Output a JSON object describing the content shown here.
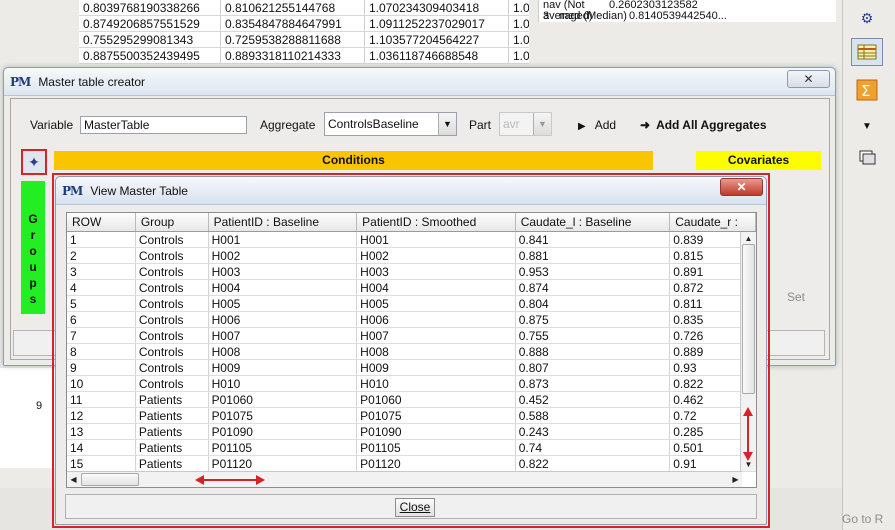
{
  "background_table": {
    "rows": [
      [
        "0.8039768190338266",
        "0.810621255144768",
        "1.070234309403418",
        "1.0"
      ],
      [
        "0.8749206857551529",
        "0.8354847884647991",
        "1.0911252237029017",
        "1.0"
      ],
      [
        "0.755295299081343",
        "0.7259538288811688",
        "1.103577204564227",
        "1.0"
      ],
      [
        "0.8875500352439495",
        "0.8893318110214333",
        "1.036118746688548",
        "1.0"
      ]
    ]
  },
  "background_list": {
    "rows": [
      {
        "index": "2",
        "label": "nav (Not averaged)",
        "value": "0.2602303123582"
      },
      {
        "index": "3",
        "label": "med (Median)",
        "value": "0.8140539442540..."
      }
    ]
  },
  "background_number": "9",
  "right_toolbar": {
    "icons": [
      "plugin-icon",
      "table-icon",
      "sum-icon",
      "dropdown-arrow-icon",
      "copy-icon"
    ]
  },
  "master_table_creator": {
    "title": "Master table creator",
    "logo": "PM",
    "variable_label": "Variable",
    "variable_value": "MasterTable",
    "aggregate_label": "Aggregate",
    "aggregate_value": "ControlsBaseline",
    "part_label": "Part",
    "part_value": "avr",
    "add_label": "Add",
    "add_all_label": "Add All Aggregates",
    "conditions_label": "Conditions",
    "covariates_label": "Covariates",
    "groups_label": [
      "G",
      "r",
      "o",
      "u",
      "p",
      "s"
    ],
    "set_label": "Set"
  },
  "view_master_table": {
    "title": "View Master Table",
    "close_label": "Close",
    "columns": [
      "ROW",
      "Group",
      "PatientID : Baseline",
      "PatientID : Smoothed",
      "Caudate_l : Baseline",
      "Caudate_r :"
    ],
    "rows": [
      [
        "1",
        "Controls",
        "H001",
        "H001",
        "0.841",
        "0.839"
      ],
      [
        "2",
        "Controls",
        "H002",
        "H002",
        "0.881",
        "0.815"
      ],
      [
        "3",
        "Controls",
        "H003",
        "H003",
        "0.953",
        "0.891"
      ],
      [
        "4",
        "Controls",
        "H004",
        "H004",
        "0.874",
        "0.872"
      ],
      [
        "5",
        "Controls",
        "H005",
        "H005",
        "0.804",
        "0.811"
      ],
      [
        "6",
        "Controls",
        "H006",
        "H006",
        "0.875",
        "0.835"
      ],
      [
        "7",
        "Controls",
        "H007",
        "H007",
        "0.755",
        "0.726"
      ],
      [
        "8",
        "Controls",
        "H008",
        "H008",
        "0.888",
        "0.889"
      ],
      [
        "9",
        "Controls",
        "H009",
        "H009",
        "0.807",
        "0.93"
      ],
      [
        "10",
        "Controls",
        "H010",
        "H010",
        "0.873",
        "0.822"
      ],
      [
        "11",
        "Patients",
        "P01060",
        "P01060",
        "0.452",
        "0.462"
      ],
      [
        "12",
        "Patients",
        "P01075",
        "P01075",
        "0.588",
        "0.72"
      ],
      [
        "13",
        "Patients",
        "P01090",
        "P01090",
        "0.243",
        "0.285"
      ],
      [
        "14",
        "Patients",
        "P01105",
        "P01105",
        "0.74",
        "0.501"
      ],
      [
        "15",
        "Patients",
        "P01120",
        "P01120",
        "0.822",
        "0.91"
      ]
    ]
  },
  "footer": {
    "goto_label": "Go to R"
  },
  "colors": {
    "conditions": "#f8c500",
    "covariates": "#fdfd00",
    "groups": "#22ee22",
    "highlight": "#d8222a"
  }
}
